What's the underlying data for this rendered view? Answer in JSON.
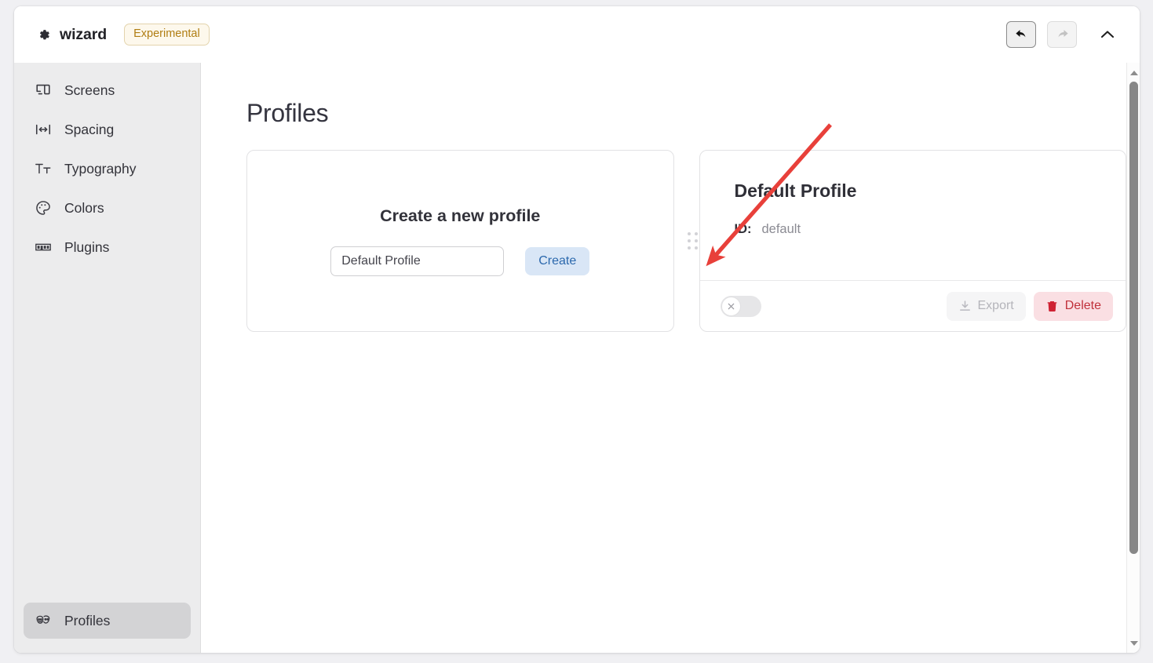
{
  "titlebar": {
    "gear_icon": "gear-icon",
    "app_name": "wizard",
    "badge": "Experimental",
    "undo_icon": "undo-arrow-icon",
    "redo_icon": "redo-arrow-icon",
    "collapse_icon": "chevron-up-icon",
    "undo_enabled": "true",
    "redo_enabled": "false"
  },
  "sidebar": {
    "items": [
      {
        "label": "Screens",
        "icon": "screens-icon",
        "active": "false"
      },
      {
        "label": "Spacing",
        "icon": "spacing-icon",
        "active": "false"
      },
      {
        "label": "Typography",
        "icon": "typography-icon",
        "active": "false"
      },
      {
        "label": "Colors",
        "icon": "palette-icon",
        "active": "false"
      },
      {
        "label": "Plugins",
        "icon": "npm-icon",
        "active": "false"
      }
    ],
    "bottom_item": {
      "label": "Profiles",
      "icon": "masks-icon",
      "active": "true"
    }
  },
  "main": {
    "page_title": "Profiles",
    "create_card": {
      "heading": "Create a new profile",
      "input_value": "Default Profile",
      "input_placeholder": "Default Profile",
      "create_label": "Create"
    },
    "profile_card": {
      "drag_handle": "drag-handle-icon",
      "name": "Default Profile",
      "id_key": "ID:",
      "id_value": "default",
      "toggle_state": "off",
      "toggle_icon": "close-x-icon",
      "export_label": "Export",
      "export_icon": "download-icon",
      "export_enabled": "false",
      "delete_label": "Delete",
      "delete_icon": "trash-icon",
      "delete_enabled": "true"
    }
  },
  "annotation": {
    "type": "arrow",
    "color": "#e8403a",
    "points_at": "create-button"
  },
  "scrollbar": {
    "up_icon": "scroll-up-arrow-icon",
    "down_icon": "scroll-down-arrow-icon",
    "thumb": "scrollbar-thumb"
  },
  "colors": {
    "accent_blue": "#2b68ad",
    "accent_blue_bg": "#d9e6f6",
    "danger_red": "#c0303a",
    "danger_red_bg": "#fadfe3",
    "badge_amber": "#b07d12",
    "badge_bg": "#fdf8ec",
    "sidebar_bg": "#ececed",
    "active_bg": "#d3d3d5",
    "annotation_red": "#e8403a"
  }
}
